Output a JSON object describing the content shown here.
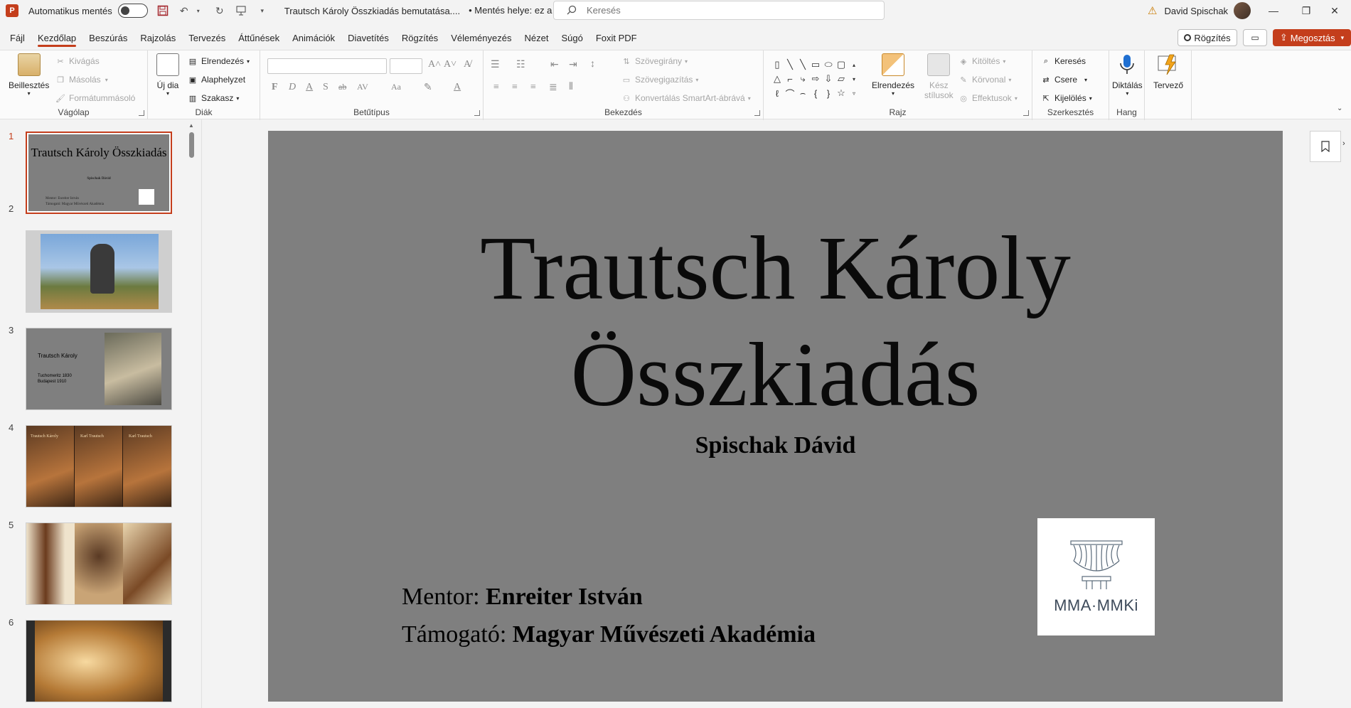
{
  "titlebar": {
    "app_letter": "P",
    "autosave_label": "Automatikus mentés",
    "doc_title": "Trautsch Károly Összkiadás bemutatása....",
    "save_location": "•  Mentés helye: ez a gép",
    "search_placeholder": "Keresés",
    "user_name": "David Spischak"
  },
  "menu": {
    "tabs": [
      "Fájl",
      "Kezdőlap",
      "Beszúrás",
      "Rajzolás",
      "Tervezés",
      "Áttűnések",
      "Animációk",
      "Diavetítés",
      "Rögzítés",
      "Véleményezés",
      "Nézet",
      "Súgó",
      "Foxit PDF"
    ],
    "active_index": 1,
    "record_label": "Rögzítés",
    "share_label": "Megosztás"
  },
  "ribbon": {
    "clipboard": {
      "label": "Vágólap",
      "paste": "Beillesztés",
      "cut": "Kivágás",
      "copy": "Másolás",
      "format_painter": "Formátummásoló"
    },
    "slides": {
      "label": "Diák",
      "new_slide": "Új dia",
      "layout": "Elrendezés",
      "reset": "Alaphelyzet",
      "section": "Szakasz"
    },
    "font": {
      "label": "Betűtípus",
      "bold": "F",
      "italic": "D",
      "underline": "A",
      "shadow": "S",
      "strike": "ab",
      "spacing": "AV",
      "case": "Aa",
      "color": "A"
    },
    "paragraph": {
      "label": "Bekezdés",
      "text_direction": "Szövegirány",
      "align_text": "Szövegigazítás",
      "smartart": "Konvertálás SmartArt-ábrává"
    },
    "drawing": {
      "label": "Rajz",
      "arrange": "Elrendezés",
      "quick_styles_1": "Kész",
      "quick_styles_2": "stílusok",
      "fill": "Kitöltés",
      "outline": "Körvonal",
      "effects": "Effektusok"
    },
    "editing": {
      "label": "Szerkesztés",
      "find": "Keresés",
      "replace": "Csere",
      "select": "Kijelölés"
    },
    "voice": {
      "label": "Hang",
      "dictate": "Diktálás"
    },
    "designer": {
      "label": "Tervező"
    }
  },
  "thumbnails": [
    {
      "num": "1",
      "title": "Trautsch Károly Összkiadás",
      "subtitle": "Spischak Dávid",
      "line1": "Mentor: Enreiter István",
      "line2": "Támogató: Magyar Művészeti Akadémia",
      "active": true
    },
    {
      "num": "2",
      "desc": "statue-photo"
    },
    {
      "num": "3",
      "title": "Trautsch Károly",
      "line1": "Tuchomeritz 1830",
      "line2": "Budapest 1910"
    },
    {
      "num": "4",
      "book1": "Trautsch Károly",
      "book2": "Karl Trautsch",
      "book3": "Karl Trautsch"
    },
    {
      "num": "5",
      "desc": "instrument-photos"
    },
    {
      "num": "6",
      "desc": "violin-photo"
    }
  ],
  "slide": {
    "title_line1": "Trautsch Károly",
    "title_line2": "Összkiadás",
    "subtitle": "Spischak Dávid",
    "mentor_label": "Mentor: ",
    "mentor_name": "Enreiter István",
    "support_label": "Támogató: ",
    "support_name": "Magyar Művészeti Akadémia",
    "logo_text": "MMA·MMKi"
  },
  "colors": {
    "accent": "#c43e1c",
    "slide_bg": "#7f7f7f"
  }
}
